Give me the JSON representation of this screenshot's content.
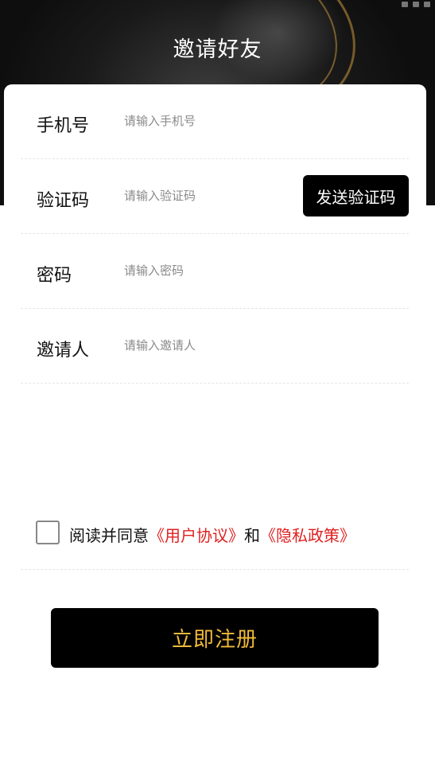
{
  "header": {
    "title": "邀请好友"
  },
  "form": {
    "phone": {
      "label": "手机号",
      "placeholder": "请输入手机号",
      "value": ""
    },
    "code": {
      "label": "验证码",
      "placeholder": "请输入验证码",
      "value": "",
      "send_label": "发送验证码"
    },
    "password": {
      "label": "密码",
      "placeholder": "请输入密码",
      "value": ""
    },
    "inviter": {
      "label": "邀请人",
      "placeholder": "请输入邀请人",
      "value": ""
    }
  },
  "agreement": {
    "checked": false,
    "prefix": "阅读并同意",
    "user_agreement": "《用户协议》",
    "and": "和",
    "privacy_policy": "《隐私政策》"
  },
  "actions": {
    "register_label": "立即注册"
  },
  "colors": {
    "accent_gold": "#f0b93a",
    "link_red": "#e02020",
    "button_black": "#000000"
  }
}
